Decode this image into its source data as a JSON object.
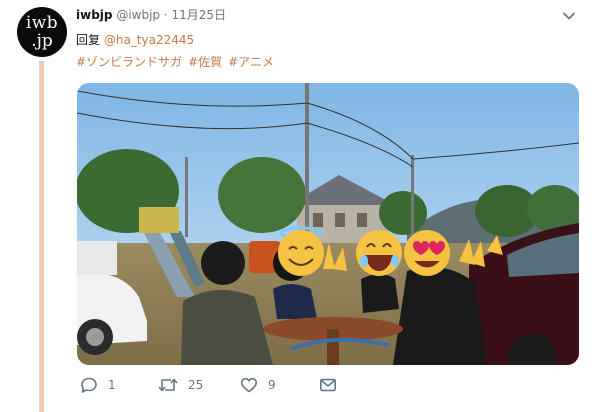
{
  "tweet": {
    "avatar_line1": "iwb",
    "avatar_line2": ".jp",
    "display_name": "iwbjp",
    "handle": "@iwbjp",
    "separator": "·",
    "date": "11月25日",
    "reply_prefix": "回复",
    "reply_to": "@ha_tya22445",
    "hashtags": [
      "#ゾンビランドサガ",
      "#佐賀",
      "#アニメ"
    ]
  },
  "actions": {
    "reply_count": "1",
    "retweet_count": "25",
    "like_count": "9"
  },
  "colors": {
    "accent": "#c77b48",
    "secondary_text": "#657786",
    "thread_line": "#f3cbb4"
  },
  "icons": [
    "chevron-down-icon",
    "reply-icon",
    "retweet-icon",
    "like-icon",
    "message-icon"
  ]
}
